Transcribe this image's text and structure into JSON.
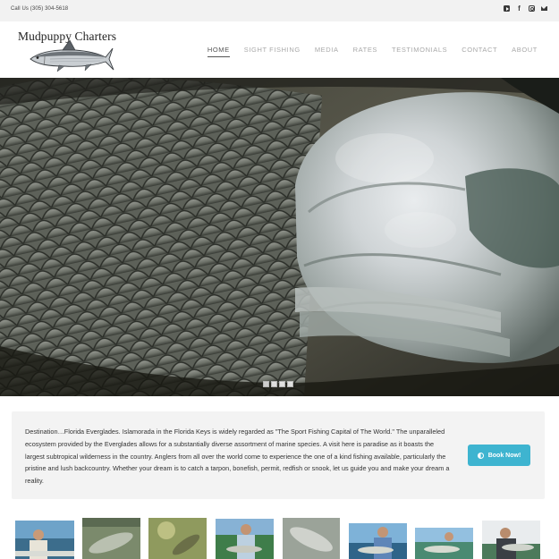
{
  "topbar": {
    "phone": "Call Us (305) 304-5618",
    "social_icons": [
      "youtube-icon",
      "facebook-icon",
      "instagram-icon",
      "email-icon"
    ]
  },
  "header": {
    "logo_text": "Mudpuppy Charters",
    "nav": [
      {
        "label": "HOME",
        "active": true
      },
      {
        "label": "SIGHT FISHING",
        "active": false
      },
      {
        "label": "MEDIA",
        "active": false
      },
      {
        "label": "RATES",
        "active": false
      },
      {
        "label": "TESTIMONIALS",
        "active": false
      },
      {
        "label": "CONTACT",
        "active": false
      },
      {
        "label": "ABOUT",
        "active": false
      }
    ]
  },
  "hero": {
    "slide_count": 4,
    "active_slide": 1
  },
  "intro": {
    "text": "Destination…Florida Everglades. Islamorada in the Florida Keys is widely regarded as \"The Sport Fishing Capital of The World.\" The unparalleled ecosystem provided by the Everglades allows for a substantially diverse assortment of marine species. A visit here is paradise as it boasts the largest subtropical wilderness in the country.  Anglers from all over the world come to experience the one of a kind fishing available, particularly the pristine and lush backcountry.  Whether your dream is to catch a tarpon, bonefish, permit, redfish or snook, let us guide you and make your dream a reality.",
    "button_label": "Book Now!",
    "button_color": "#3eb4d0"
  },
  "gallery": {
    "thumbnail_count": 8
  }
}
